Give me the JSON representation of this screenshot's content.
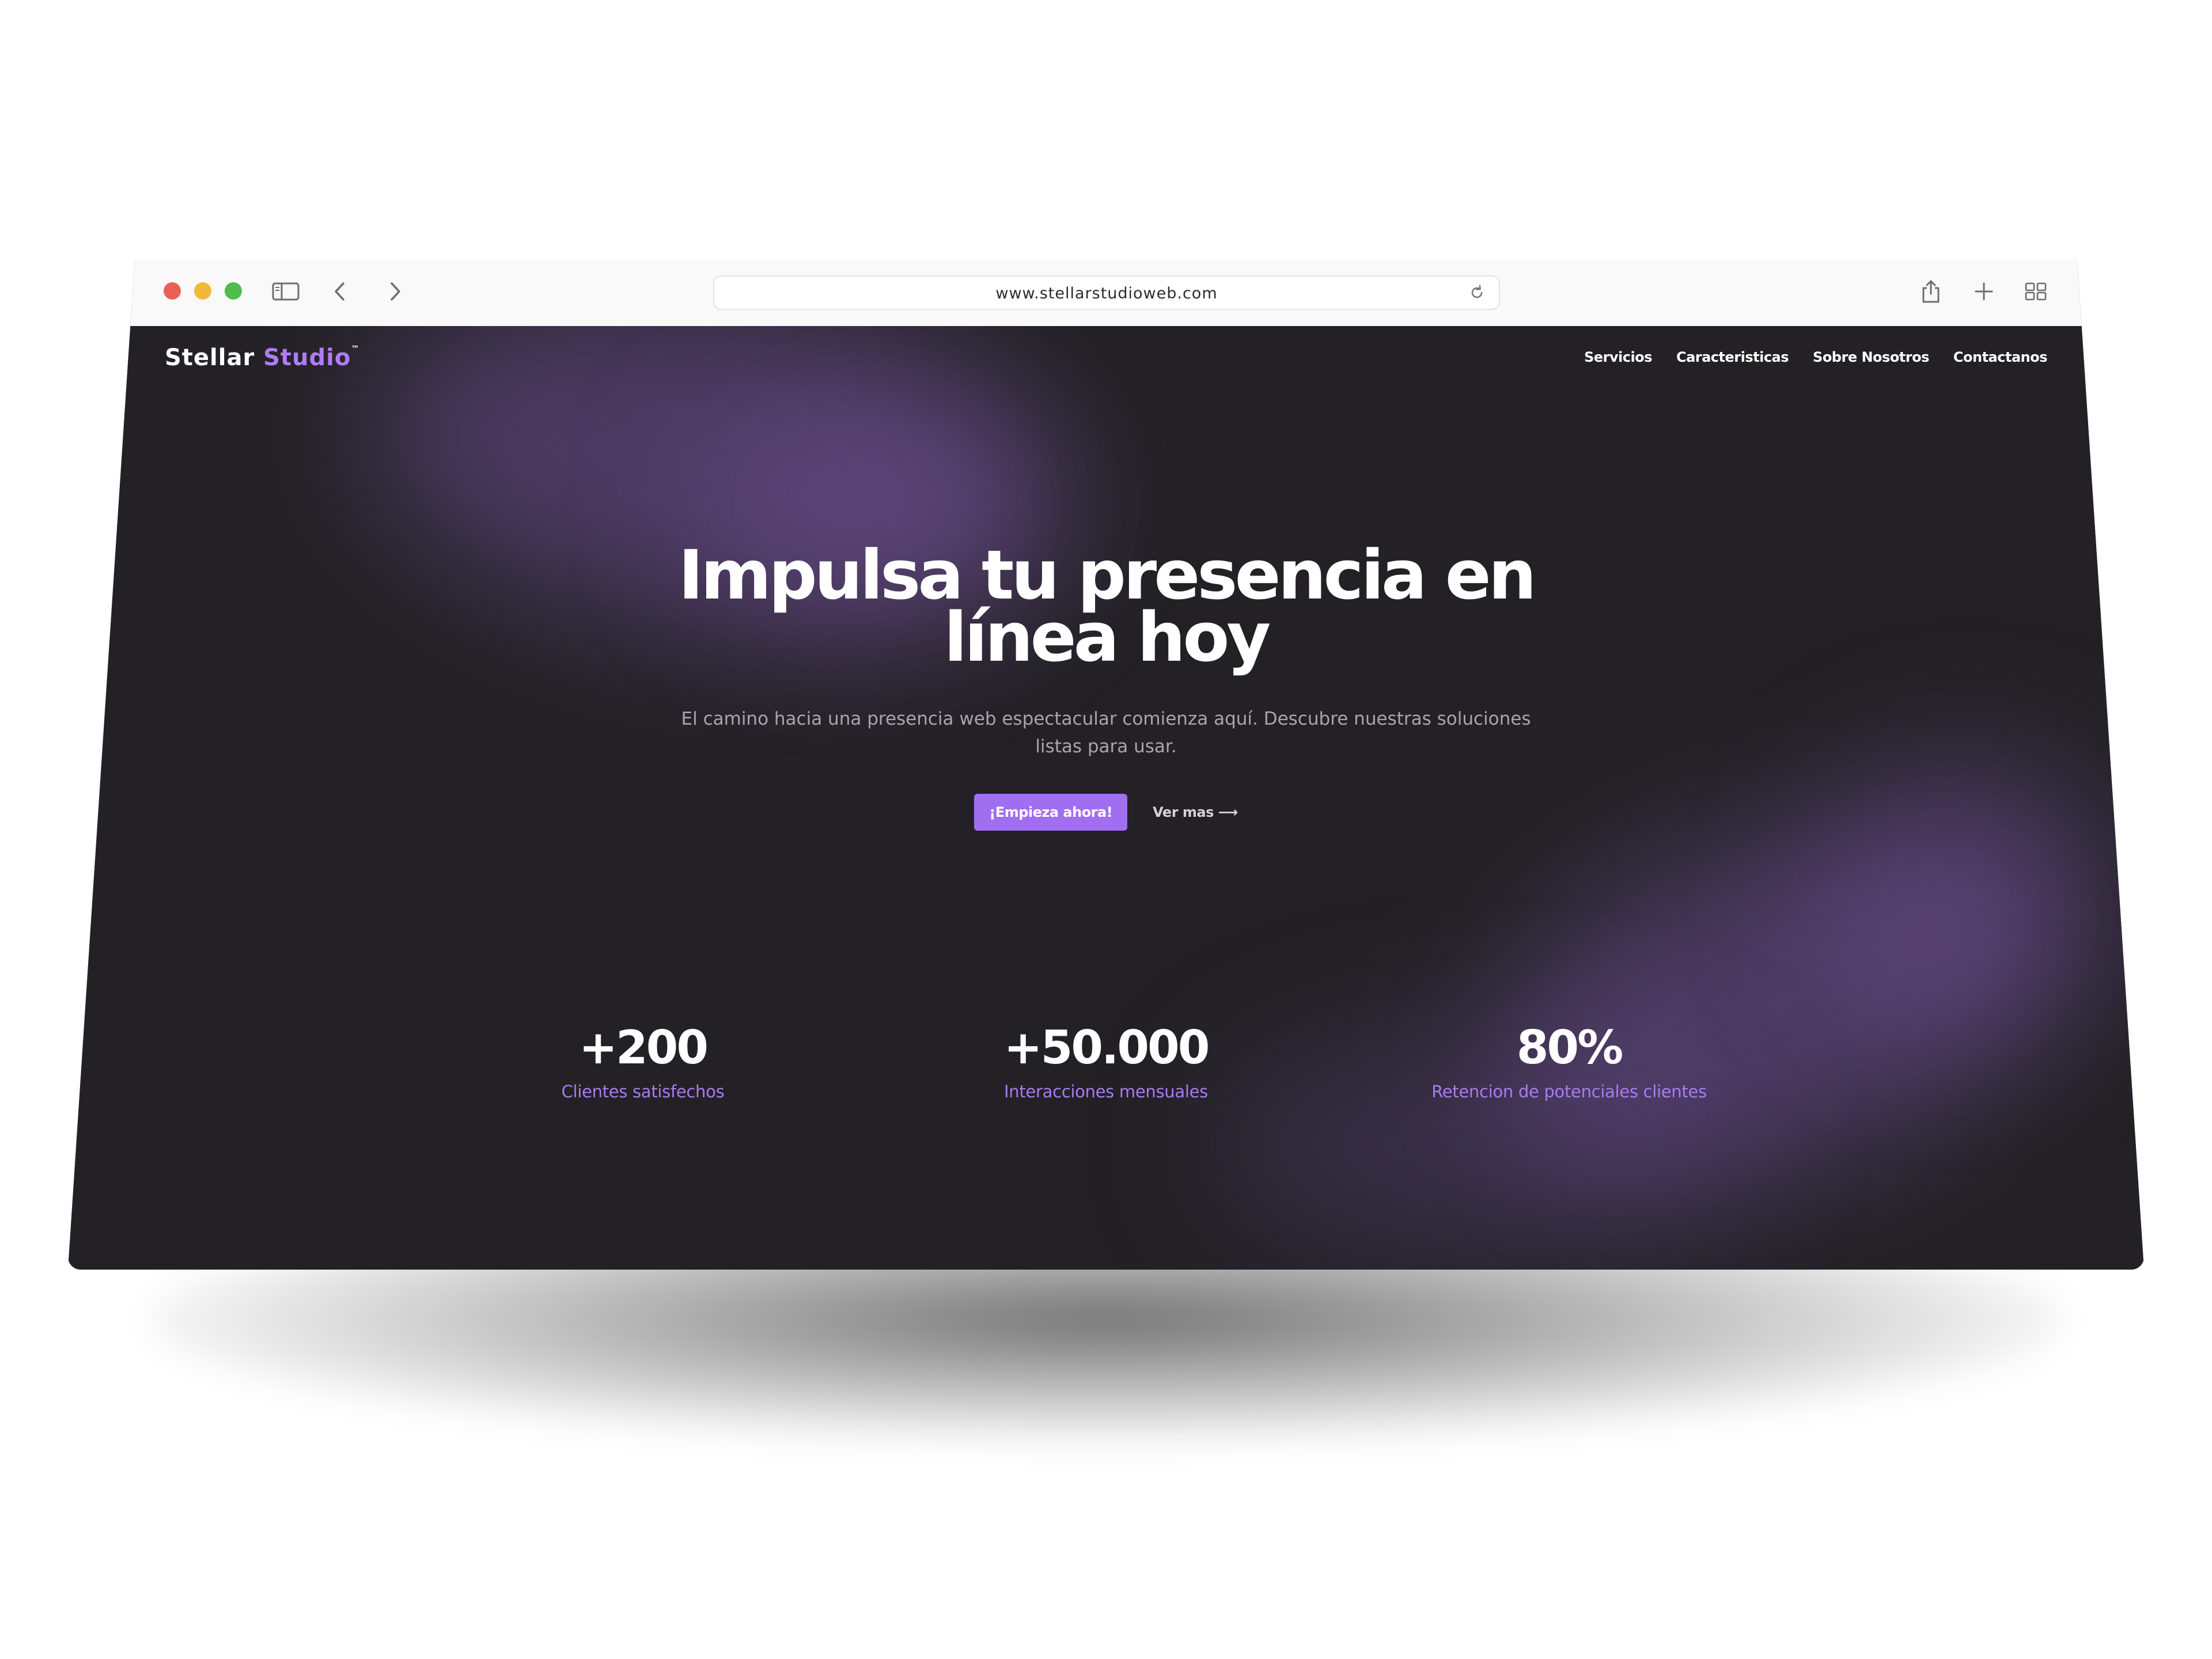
{
  "browser": {
    "url": "www.stellarstudioweb.com",
    "icons": {
      "sidebar": "sidebar-icon",
      "back": "chevron-left-icon",
      "forward": "chevron-right-icon",
      "reload": "reload-icon",
      "share": "share-icon",
      "new_tab": "plus-icon",
      "tabs": "tab-overview-icon"
    }
  },
  "site": {
    "logo": {
      "part1": "Stellar ",
      "part2": "Studio",
      "tm": "™"
    },
    "nav": [
      "Servicios",
      "Caracteristicas",
      "Sobre Nosotros",
      "Contactanos"
    ],
    "hero": {
      "title_line1": "Impulsa tu presencia en",
      "title_line2": "línea hoy",
      "subtitle_line1": "El camino hacia una presencia web espectacular comienza aquí. Descubre nuestras soluciones",
      "subtitle_line2": "listas para usar.",
      "cta_primary": "¡Empieza ahora!",
      "cta_secondary": "Ver mas ⟶"
    },
    "stats": [
      {
        "value": "+200",
        "label": "Clientes satisfechos"
      },
      {
        "value": "+50.000",
        "label": "Interacciones mensuales"
      },
      {
        "value": "80%",
        "label": "Retencion de potenciales clientes"
      }
    ]
  },
  "colors": {
    "page_background": "#232125",
    "accent": "#a06ef0",
    "accent_text": "#a77cf0",
    "toolbar": "#f9f9fa"
  }
}
